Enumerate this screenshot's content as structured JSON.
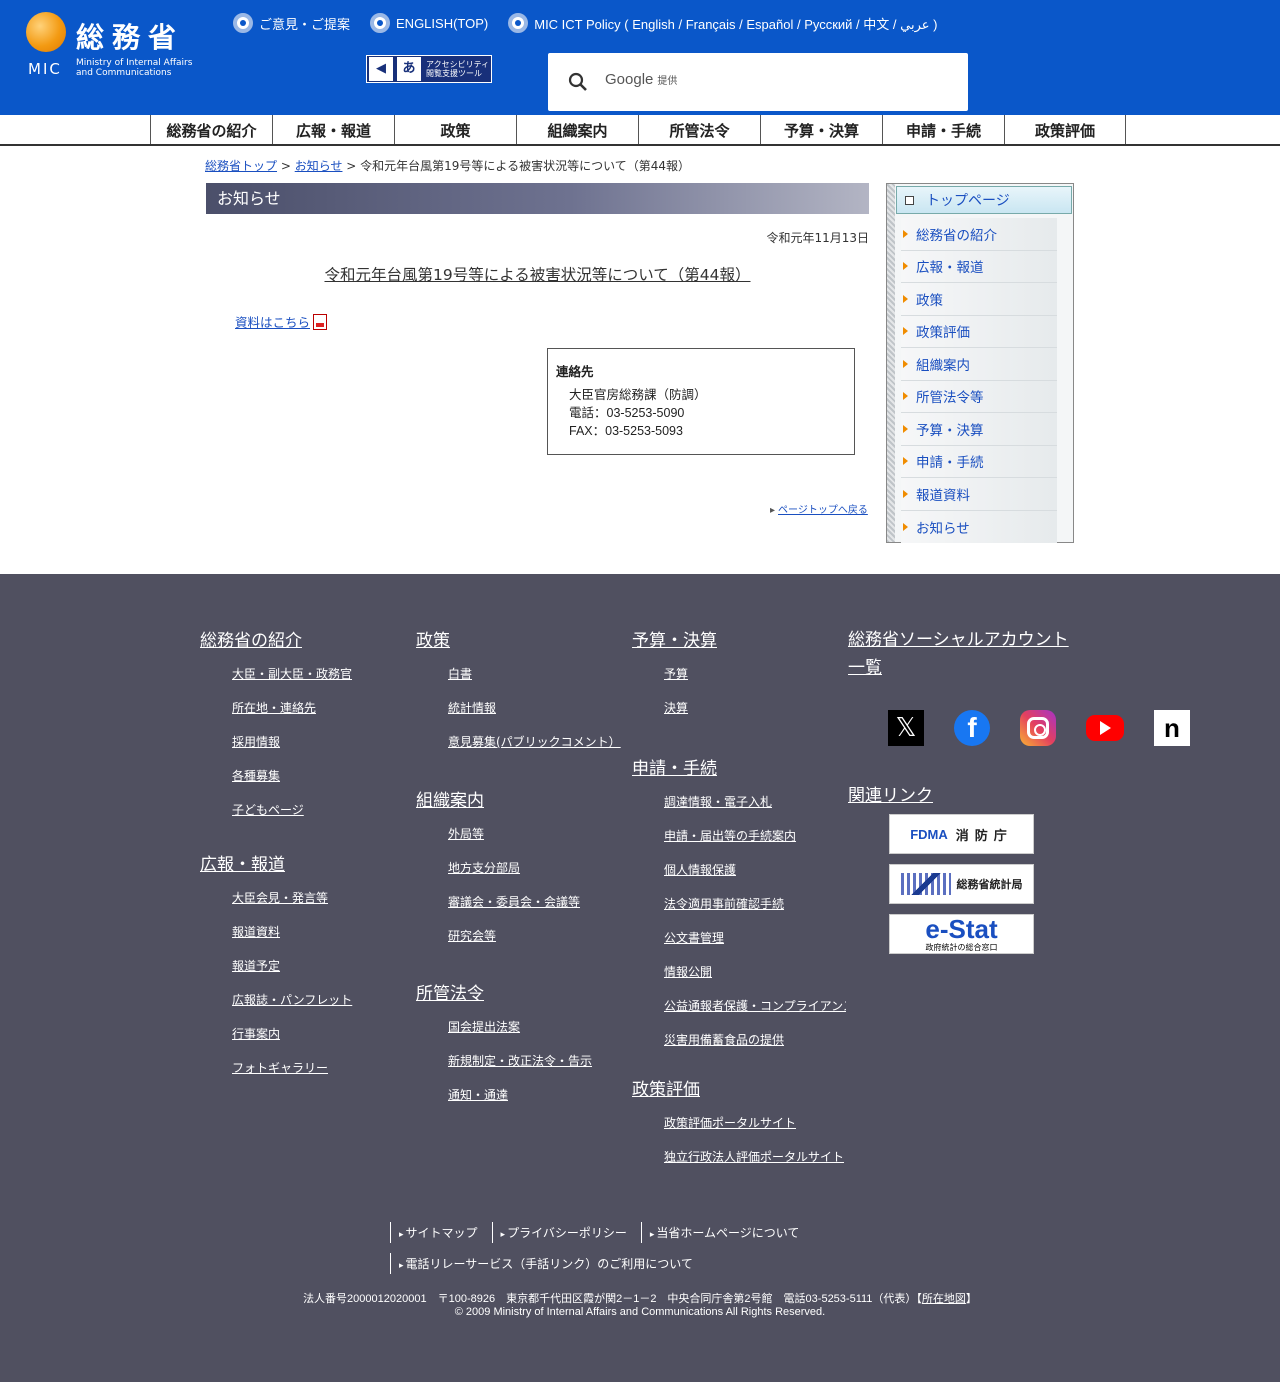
{
  "header": {
    "logo_kanji": "総務省",
    "logo_mic": "MIC",
    "logo_sub_line1": "Ministry of Internal Affairs",
    "logo_sub_line2": "and Communications",
    "links": [
      "ご意見・ご提案",
      "ENGLISH(TOP)",
      "MIC ICT Policy ( English / Français / Español / Русский / 中文 / عربي )"
    ],
    "accessibility_line1": "アクセシビリティ",
    "accessibility_line2": "閲覧支援ツール",
    "search_brand": "Google",
    "search_suffix": "提供"
  },
  "nav": [
    "総務省の紹介",
    "広報・報道",
    "政策",
    "組織案内",
    "所管法令",
    "予算・決算",
    "申請・手続",
    "政策評価"
  ],
  "breadcrumb": {
    "home": "総務省トップ",
    "sep1": " > ",
    "news": "お知らせ",
    "sep2": " > ",
    "current": "令和元年台風第19号等による被害状況等について（第44報）"
  },
  "main": {
    "section_title": "お知らせ",
    "date": "令和元年11月13日",
    "title": "令和元年台風第19号等による被害状況等について（第44報）",
    "doc_link": "資料はこちら",
    "contact": {
      "title": "連絡先",
      "dept": "大臣官房総務課（防調）",
      "tel": "電話：03-5253-5090",
      "fax": "FAX：03-5253-5093"
    },
    "page_top": "ページトップへ戻る"
  },
  "sidebar": {
    "top": "トップページ",
    "items": [
      "総務省の紹介",
      "広報・報道",
      "政策",
      "政策評価",
      "組織案内",
      "所管法令等",
      "予算・決算",
      "申請・手続",
      "報道資料",
      "お知らせ"
    ]
  },
  "footer": {
    "col1": [
      {
        "head": "総務省の紹介",
        "links": [
          "大臣・副大臣・政務官",
          "所在地・連絡先",
          "採用情報",
          "各種募集",
          "子どもページ"
        ]
      },
      {
        "head": "広報・報道",
        "links": [
          "大臣会見・発言等",
          "報道資料",
          "報道予定",
          "広報誌・パンフレット",
          "行事案内",
          "フォトギャラリー"
        ]
      }
    ],
    "col2": [
      {
        "head": "政策",
        "links": [
          "白書",
          "統計情報",
          "意見募集(パブリックコメント）"
        ]
      },
      {
        "head": "組織案内",
        "links": [
          "外局等",
          "地方支分部局",
          "審議会・委員会・会議等",
          "研究会等"
        ]
      },
      {
        "head": "所管法令",
        "links": [
          "国会提出法案",
          "新規制定・改正法令・告示",
          "通知・通達"
        ]
      }
    ],
    "col3": [
      {
        "head": "予算・決算",
        "links": [
          "予算",
          "決算"
        ]
      },
      {
        "head": "申請・手続",
        "links": [
          "調達情報・電子入札",
          "申請・届出等の手続案内",
          "個人情報保護",
          "法令適用事前確認手続",
          "公文書管理",
          "情報公開",
          "公益通報者保護・コンプライアンス",
          "災害用備蓄食品の提供"
        ]
      },
      {
        "head": "政策評価",
        "links": [
          "政策評価ポータルサイト",
          "独立行政法人評価ポータルサイト"
        ]
      }
    ],
    "social_head": "総務省ソーシャルアカウント一覧",
    "social_icons": [
      "x-icon",
      "facebook-icon",
      "instagram-icon",
      "youtube-icon",
      "note-icon"
    ],
    "related_head": "関連リンク",
    "banners": {
      "fdma_left": "FDMA",
      "fdma_right": "消防庁",
      "stat": "総務省統計局",
      "estat_big": "e-Stat",
      "estat_small": "政府統計の総合窓口"
    },
    "bottom_links_row1": [
      "サイトマップ",
      "プライバシーポリシー",
      "当省ホームページについて"
    ],
    "bottom_links_row2": [
      "電話リレーサービス（手話リンク）のご利用について"
    ],
    "corp_text": "法人番号2000012020001　〒100-8926　東京都千代田区霞が関2－1－2　中央合同庁舎第2号館　電話03-5253-5111（代表）【",
    "corp_map": "所在地図",
    "corp_end": "】",
    "copyright": "© 2009 Ministry of Internal Affairs and Communications All Rights Reserved."
  },
  "colors": {
    "header_bg": "#0a57c9",
    "footer_bg": "#505060",
    "link": "#1a4fc0",
    "accent_orange": "#f08c00"
  }
}
